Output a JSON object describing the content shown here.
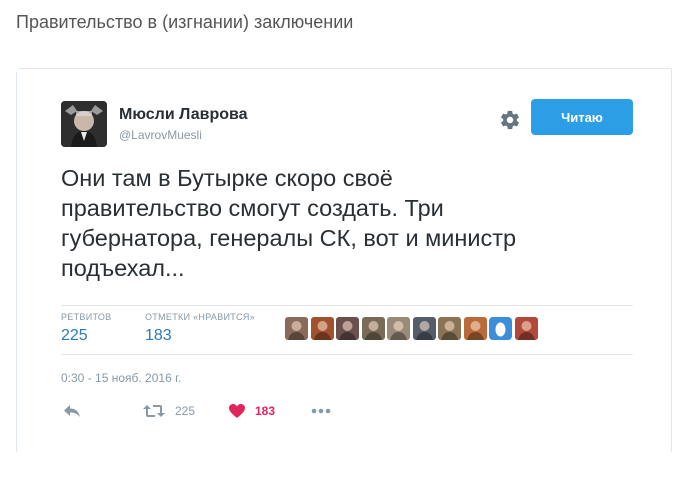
{
  "page": {
    "title": "Правительство в (изгнании) заключении"
  },
  "tweet": {
    "user": {
      "name": "Мюсли Лаврова",
      "handle": "@LavrovMuesli"
    },
    "follow_label": "Читаю",
    "text": "Они там в Бутырке скоро своё\nправительство смогут создать. Три\nгубернатора, генералы СК, вот и министр\nподъехал...",
    "stats": {
      "retweets_label": "РЕТВИТОВ",
      "retweets_value": "225",
      "likes_label": "ОТМЕТКИ «НРАВИТСЯ»",
      "likes_value": "183"
    },
    "liker_avatars": [
      "#8a6a5a",
      "#a0522d",
      "#6b4f4f",
      "#7a6a58",
      "#9a8a7a",
      "#555c6a",
      "#8b7355",
      "#b86a3a",
      "#3b8fd9",
      "#b04a3a"
    ],
    "timestamp": "0:30 - 15 нояб. 2016 г.",
    "actions": {
      "reply_icon": "reply-icon",
      "retweet_icon": "retweet-icon",
      "retweet_count": "225",
      "like_icon": "heart-icon",
      "like_count": "183",
      "more_icon": "more-icon"
    },
    "colors": {
      "accent": "#2b9ee6",
      "link": "#2b7bb9",
      "like": "#e0245e",
      "muted": "#8899a6",
      "text": "#292f33"
    }
  }
}
